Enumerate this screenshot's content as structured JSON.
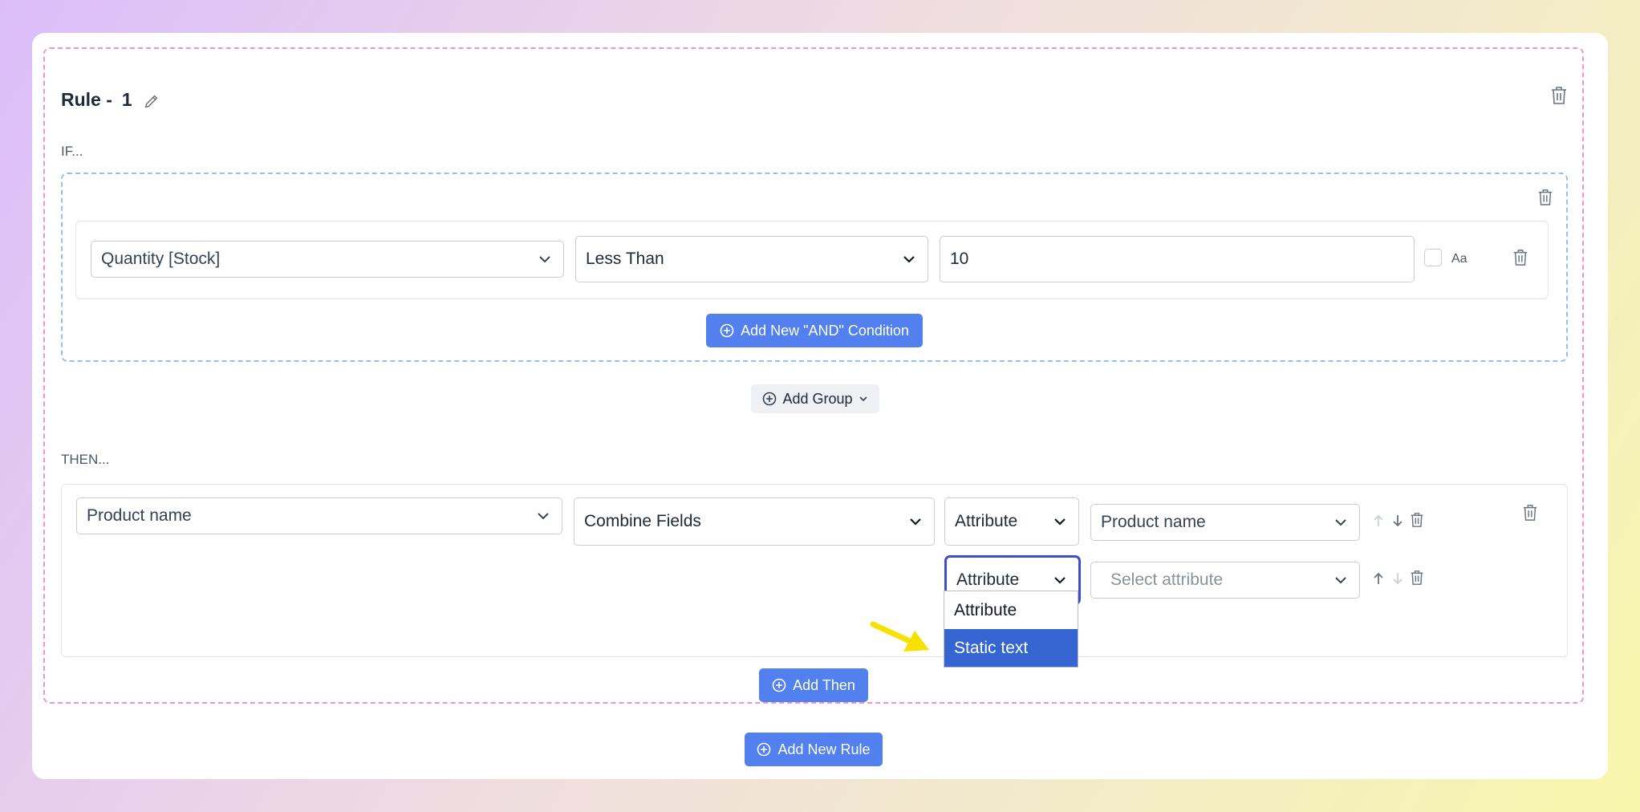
{
  "rule": {
    "title_prefix": "Rule -",
    "number": "1",
    "if_label": "IF...",
    "then_label": "THEN...",
    "condition": {
      "field": "Quantity [Stock]",
      "operator": "Less Than",
      "value": "10",
      "case_label": "Aa"
    },
    "add_and_label": "Add New \"AND\" Condition",
    "add_group_label": "Add Group",
    "then_row": {
      "target_field": "Product name",
      "action": "Combine Fields",
      "parts": [
        {
          "type": "Attribute",
          "value": "Product name"
        },
        {
          "type": "Attribute",
          "value_placeholder": "Select attribute"
        }
      ]
    },
    "dropdown_options": [
      "Attribute",
      "Static text"
    ],
    "dropdown_selected": "Static text",
    "add_then_label": "Add Then"
  },
  "add_new_rule_label": "Add New Rule",
  "colors": {
    "primary_button": "#5280ee",
    "rule_border": "#ee96c6",
    "group_border": "#93c1f1",
    "dropdown_highlight": "#3465d1",
    "focus_ring": "#3b4fcc",
    "annotation_arrow": "#f7e100"
  }
}
